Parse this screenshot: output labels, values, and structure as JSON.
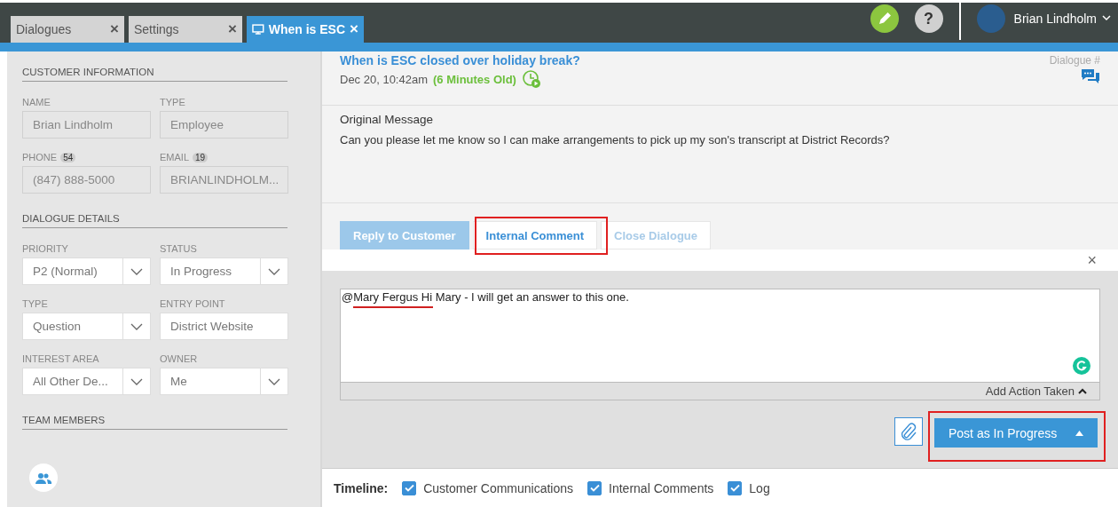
{
  "app_tabs": [
    {
      "label": "Dialogues",
      "selected": false,
      "close": "×"
    },
    {
      "label": "Settings",
      "selected": false,
      "close": "×"
    },
    {
      "label": "When is ESC",
      "selected": true,
      "close": "×"
    }
  ],
  "help": "?",
  "user": {
    "name": "Brian Lindholm"
  },
  "sidebar": {
    "sections": [
      {
        "title": "CUSTOMER INFORMATION",
        "fields": [
          {
            "label": "NAME",
            "kind": "readonly",
            "value": "Brian Lindholm"
          },
          {
            "label": "TYPE",
            "kind": "readonly",
            "value": "Employee"
          },
          {
            "label": "PHONE",
            "badge": "54",
            "kind": "readonly",
            "value": "(847) 888-5000"
          },
          {
            "label": "EMAIL",
            "badge": "19",
            "kind": "readonly",
            "value": "BRIANLINDHOLM..."
          }
        ]
      },
      {
        "title": "DIALOGUE DETAILS",
        "fields": [
          {
            "label": "PRIORITY",
            "kind": "select",
            "value": "P2 (Normal)"
          },
          {
            "label": "STATUS",
            "kind": "select",
            "value": "In Progress"
          },
          {
            "label": "TYPE",
            "kind": "select",
            "value": "Question"
          },
          {
            "label": "ENTRY POINT",
            "kind": "text",
            "value": "District Website"
          },
          {
            "label": "INTEREST AREA",
            "kind": "select",
            "value": "All Other De..."
          },
          {
            "label": "OWNER",
            "kind": "select",
            "value": "Me"
          }
        ]
      },
      {
        "title": "TEAM MEMBERS"
      }
    ]
  },
  "dialogue": {
    "title": "When is ESC closed over holiday break?",
    "number": "Dialogue #",
    "date": "Dec 20, 10:42am",
    "age": "(6 Minutes Old)",
    "original_heading": "Original Message",
    "original_text": "Can you please let me know so I can make arrangements to pick up my son's transcript at District Records?"
  },
  "reply_tabs": [
    {
      "label": "Reply to Customer",
      "selected": false
    },
    {
      "label": "Internal Comment",
      "selected": true
    },
    {
      "label": "Close Dialogue",
      "selected": false
    }
  ],
  "composer": {
    "close": "×",
    "value": "@Mary Fergus Hi Mary - I will get an answer to this one.",
    "action_link": "Add Action Taken",
    "post_button": "Post as In Progress"
  },
  "timeline": {
    "label": "Timeline:",
    "options": [
      {
        "label": "Customer Communications",
        "checked": true
      },
      {
        "label": "Internal Comments",
        "checked": true
      },
      {
        "label": "Log",
        "checked": true
      }
    ]
  }
}
